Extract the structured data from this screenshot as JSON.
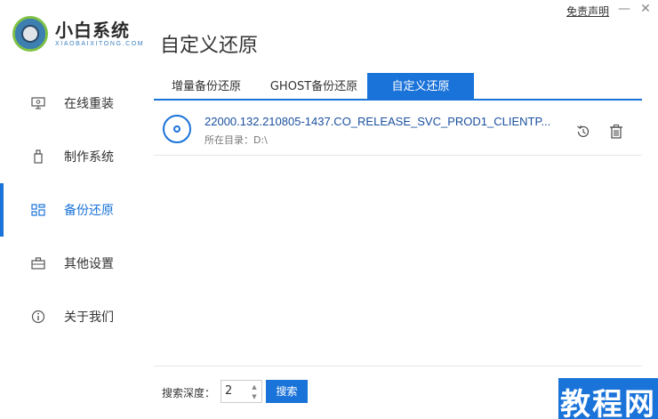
{
  "app": {
    "title": "小白系统",
    "subtitle": "XIAOBAIXITONG.COM",
    "disclaimer": "免责声明",
    "minimize": "—",
    "close": "✕"
  },
  "sidebar": {
    "items": [
      {
        "label": "在线重装",
        "icon": "monitor-icon"
      },
      {
        "label": "制作系统",
        "icon": "usb-icon"
      },
      {
        "label": "备份还原",
        "icon": "grid-icon",
        "active": true
      },
      {
        "label": "其他设置",
        "icon": "briefcase-icon"
      },
      {
        "label": "关于我们",
        "icon": "info-icon"
      }
    ]
  },
  "page": {
    "title": "自定义还原"
  },
  "tabs": [
    {
      "label": "增量备份还原"
    },
    {
      "label": "GHOST备份还原"
    },
    {
      "label": "自定义还原",
      "active": true
    }
  ],
  "backups": [
    {
      "name": "22000.132.210805-1437.CO_RELEASE_SVC_PROD1_CLIENTP...",
      "dir": "所在目录：D:\\"
    }
  ],
  "bottom": {
    "depth_label": "搜索深度：",
    "depth_value": "2",
    "search_label": "搜索"
  },
  "watermark": "教程网",
  "colors": {
    "accent": "#1a73d9"
  }
}
